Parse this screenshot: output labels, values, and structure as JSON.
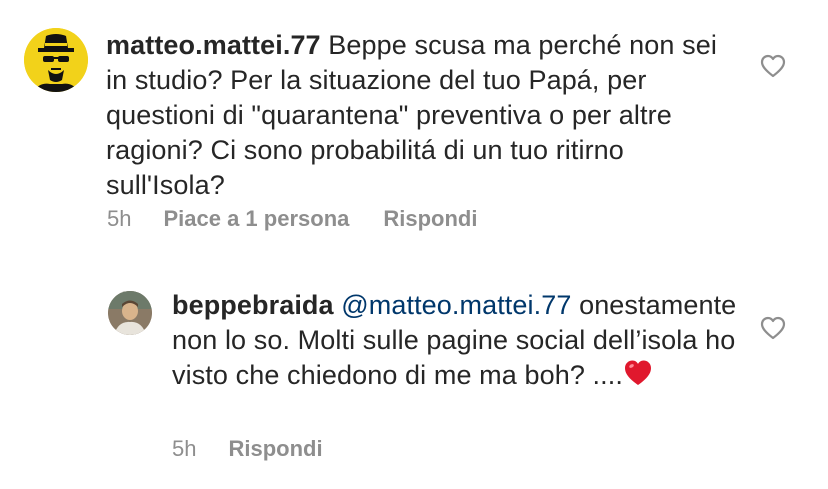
{
  "comments": [
    {
      "username": "matteo.mattei.77",
      "mention": "",
      "text": "Beppe scusa ma perché non sei in studio? Per la situazione del tuo Papá, per questioni di \"quarantena\" preventiva o per altre ragioni? Ci sono probabilitá di un tuo ritirno sull'Isola?",
      "time": "5h",
      "likes_label": "Piace a 1 persona",
      "reply_label": "Rispondi"
    },
    {
      "username": "beppebraida",
      "mention": "@matteo.mattei.77",
      "text": "onestamente non lo so. Molti sulle pagine social dell’isola ho visto  che chiedono di me ma boh? ....",
      "emoji": "red-heart",
      "time": "5h",
      "reply_label": "Rispondi"
    }
  ],
  "colors": {
    "text": "#262626",
    "meta": "#8e8e8e",
    "mention": "#00376b",
    "heart_emoji": "#e0182d"
  },
  "icons": {
    "like": "heart-outline-icon",
    "avatar1": "heisenberg-avatar",
    "avatar2": "profile-photo-avatar"
  }
}
